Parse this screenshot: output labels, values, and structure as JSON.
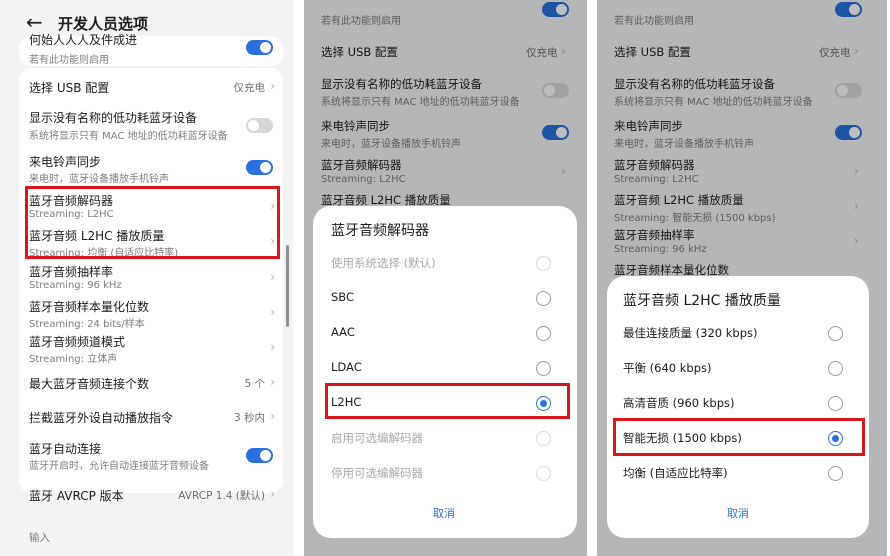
{
  "panel1": {
    "title": "开发人员选项",
    "top_partial": {
      "title": "何始人人人及件成进",
      "subtitle": "若有此功能则启用"
    },
    "usb": {
      "label": "选择 USB 配置",
      "value": "仅充电"
    },
    "ble_noname": {
      "title": "显示没有名称的低功耗蓝牙设备",
      "subtitle": "系统将显示只有 MAC 地址的低功耗蓝牙设备"
    },
    "ringtone": {
      "title": "来电铃声同步",
      "subtitle": "来电时，蓝牙设备播放手机铃声"
    },
    "codec": {
      "title": "蓝牙音频解码器",
      "subtitle": "Streaming: L2HC"
    },
    "quality": {
      "title": "蓝牙音频 L2HC 播放质量",
      "subtitle": "Streaming: 均衡 (自适应比特率)"
    },
    "sample_rate": {
      "title": "蓝牙音频抽样率",
      "subtitle": "Streaming: 96 kHz"
    },
    "bits": {
      "title": "蓝牙音频样本量化位数",
      "subtitle": "Streaming: 24 bits/样本"
    },
    "channel": {
      "title": "蓝牙音频频道模式",
      "subtitle": "Streaming: 立体声"
    },
    "max_conn": {
      "label": "最大蓝牙音频连接个数",
      "value": "5 个"
    },
    "intercept": {
      "label": "拦截蓝牙外设自动播放指令",
      "value": "3 秒内"
    },
    "auto_conn": {
      "title": "蓝牙自动连接",
      "subtitle": "蓝牙开启时，允许自动连接蓝牙音频设备"
    },
    "avrcp": {
      "label": "蓝牙 AVRCP 版本",
      "value": "AVRCP 1.4 (默认)"
    },
    "section_input": "输入"
  },
  "bg_common": {
    "top_sub": "若有此功能则启用",
    "usb": {
      "label": "选择 USB 配置",
      "value": "仅充电"
    },
    "ble_noname": {
      "title": "显示没有名称的低功耗蓝牙设备",
      "subtitle": "系统将显示只有 MAC 地址的低功耗蓝牙设备"
    },
    "ringtone": {
      "title": "来电铃声同步",
      "subtitle": "来电时，蓝牙设备播放手机铃声"
    },
    "codec": {
      "title": "蓝牙音频解码器",
      "subtitle": "Streaming: L2HC"
    },
    "quality_title": "蓝牙音频 L2HC 播放质量"
  },
  "panel3_bg": {
    "quality_sub": "Streaming: 智能无损 (1500 kbps)",
    "sample_rate": {
      "title": "蓝牙音频抽样率",
      "subtitle": "Streaming: 96 kHz"
    },
    "bits_title": "蓝牙音频样本量化位数"
  },
  "codec_dialog": {
    "title": "蓝牙音频解码器",
    "options": [
      "使用系统选择 (默认)",
      "SBC",
      "AAC",
      "LDAC",
      "L2HC",
      "启用可选编解码器",
      "停用可选编解码器"
    ],
    "selected": "L2HC",
    "cancel": "取消"
  },
  "quality_dialog": {
    "title": "蓝牙音频 L2HC 播放质量",
    "options": [
      "最佳连接质量 (320 kbps)",
      "平衡 (640 kbps)",
      "高清音质 (960 kbps)",
      "智能无损 (1500 kbps)",
      "均衡 (自适应比特率)"
    ],
    "selected": "智能无损 (1500 kbps)",
    "cancel": "取消"
  },
  "colors": {
    "accent": "#2a6fdb",
    "highlight_box": "#d8161b",
    "toggle_off": "#d7d7d7"
  },
  "toggles": {
    "top_partial": true,
    "ble_noname": false,
    "ringtone": true,
    "auto_conn": true
  }
}
